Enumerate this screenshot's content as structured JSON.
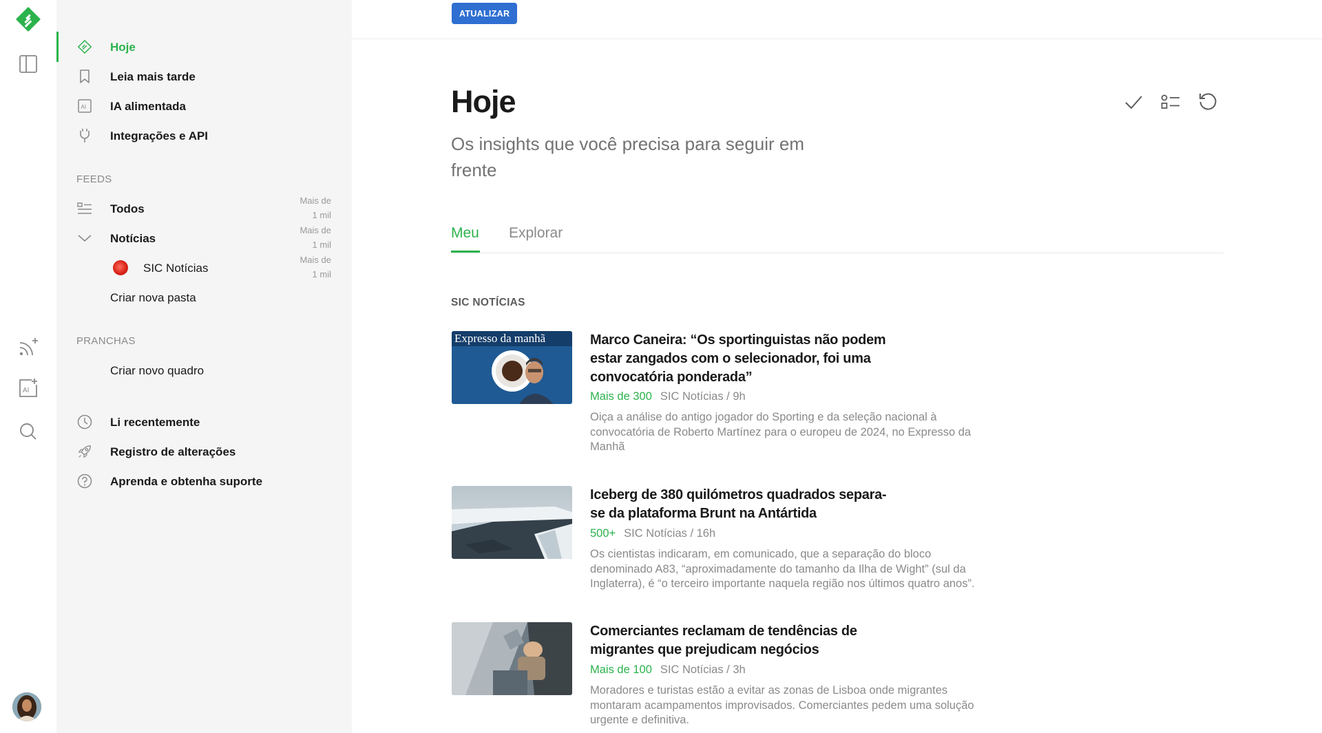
{
  "rail": {
    "icons": [
      "feedly-logo-icon",
      "sidebar-toggle-icon",
      "add-feed-icon",
      "ai-feed-icon",
      "search-icon"
    ]
  },
  "sidebar": {
    "top_items": [
      {
        "label": "Hoje",
        "icon": "today-icon"
      },
      {
        "label": "Leia mais tarde",
        "icon": "bookmark-icon"
      },
      {
        "label": "IA alimentada",
        "icon": "ai-icon"
      },
      {
        "label": "Integrações e API",
        "icon": "plug-icon"
      }
    ],
    "feeds_title": "FEEDS",
    "feeds": [
      {
        "label": "Todos",
        "count_line1": "Mais de",
        "count_line2": "1 mil"
      },
      {
        "label": "Notícias",
        "count_line1": "Mais de",
        "count_line2": "1 mil"
      },
      {
        "label": "SIC Notícias",
        "count_line1": "Mais de",
        "count_line2": "1 mil"
      }
    ],
    "create_folder": "Criar nova pasta",
    "boards_title": "PRANCHAS",
    "create_board": "Criar novo quadro",
    "bottom_items": [
      {
        "label": "Li recentemente",
        "icon": "clock-icon"
      },
      {
        "label": "Registro de alterações",
        "icon": "rocket-icon"
      },
      {
        "label": "Aprenda e obtenha suporte",
        "icon": "help-icon"
      }
    ]
  },
  "main": {
    "refresh_label": "ATUALIZAR",
    "title": "Hoje",
    "subtitle": "Os insights que você precisa para seguir em frente",
    "tabs": [
      "Meu",
      "Explorar"
    ],
    "source_heading": "SIC NOTÍCIAS",
    "thumb_caption": "Expresso da manhã",
    "articles": [
      {
        "title": "Marco Caneira: “Os sportinguistas não podem estar zangados com o selecionador, foi uma convocatória ponderada”",
        "popularity": "Mais de 300",
        "source": "SIC Notícias / 9h",
        "summary": "Oiça a análise do antigo jogador do Sporting e da seleção nacional à convocatória de Roberto Martínez para o europeu de 2024, no Expresso da Manhã"
      },
      {
        "title": "Iceberg de 380 quilómetros quadrados separa-se da plataforma Brunt na Antártida",
        "popularity": "500+",
        "source": "SIC Notícias / 16h",
        "summary": "Os cientistas indicaram, em comunicado, que a separação do bloco denominado A83, “aproximadamente do tamanho da Ilha de Wight” (sul da Inglaterra), é “o terceiro importante naquela região nos últimos quatro anos”."
      },
      {
        "title": "Comerciantes reclamam de tendências de migrantes que prejudicam negócios",
        "popularity": "Mais de 100",
        "source": "SIC Notícias / 3h",
        "summary": "Moradores e turistas estão a evitar as zonas de Lisboa onde migrantes montaram acampamentos improvisados. Comerciantes pedem uma solução urgente e definitiva."
      }
    ]
  },
  "colors": {
    "accent": "#2bb24c",
    "button": "#2e6fd1",
    "sidebar_bg": "#f5f5f5"
  }
}
